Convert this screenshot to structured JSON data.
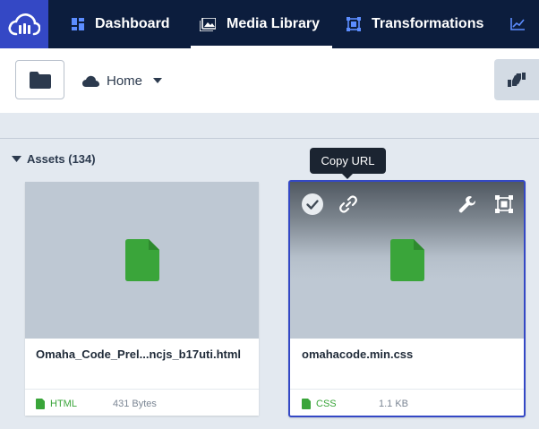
{
  "nav": {
    "items": [
      {
        "label": "Dashboard",
        "icon": "dashboard-icon"
      },
      {
        "label": "Media Library",
        "icon": "media-library-icon",
        "active": true
      },
      {
        "label": "Transformations",
        "icon": "transformations-icon"
      },
      {
        "label": "",
        "icon": "reports-icon"
      }
    ]
  },
  "toolbar": {
    "breadcrumb": "Home"
  },
  "assets": {
    "header": "Assets (134)",
    "tooltip": "Copy URL",
    "items": [
      {
        "filename": "Omaha_Code_Prel...ncjs_b17uti.html",
        "type": "HTML",
        "size": "431 Bytes"
      },
      {
        "filename": "omahacode.min.css",
        "type": "CSS",
        "size": "1.1 KB",
        "selected": true
      }
    ]
  },
  "colors": {
    "nav_bg": "#0c1d3d",
    "brand": "#3448c5",
    "file_green": "#3aa53a",
    "select_border": "#3448c5"
  }
}
